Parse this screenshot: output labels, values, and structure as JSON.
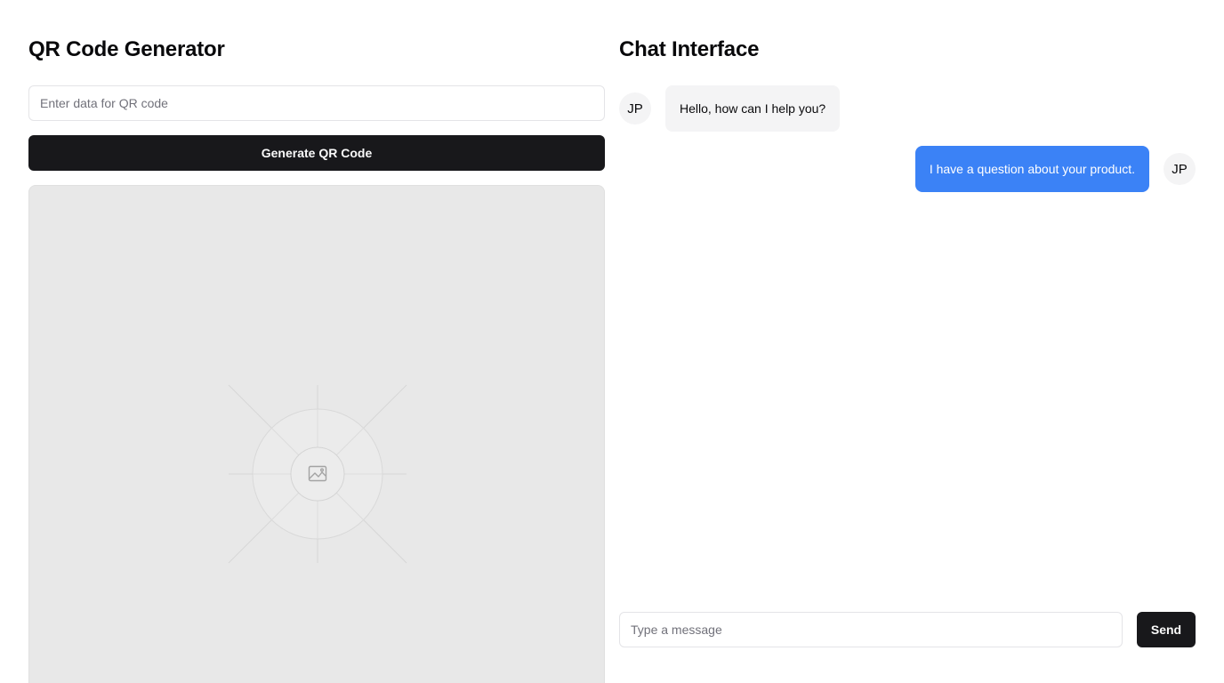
{
  "qr_generator": {
    "title": "QR Code Generator",
    "input_placeholder": "Enter data for QR code",
    "input_value": "",
    "generate_label": "Generate QR Code",
    "preview_icon": "image-icon"
  },
  "chat": {
    "title": "Chat Interface",
    "messages": [
      {
        "sender": "incoming",
        "avatar": "JP",
        "text": "Hello, how can I help you?"
      },
      {
        "sender": "outgoing",
        "avatar": "JP",
        "text": "I have a question about your product."
      }
    ],
    "input_placeholder": "Type a message",
    "input_value": "",
    "send_label": "Send"
  },
  "colors": {
    "primary_button": "#18181b",
    "outgoing_bubble": "#3b82f6",
    "incoming_bubble": "#f4f4f5",
    "placeholder_bg": "#e8e8e8"
  }
}
